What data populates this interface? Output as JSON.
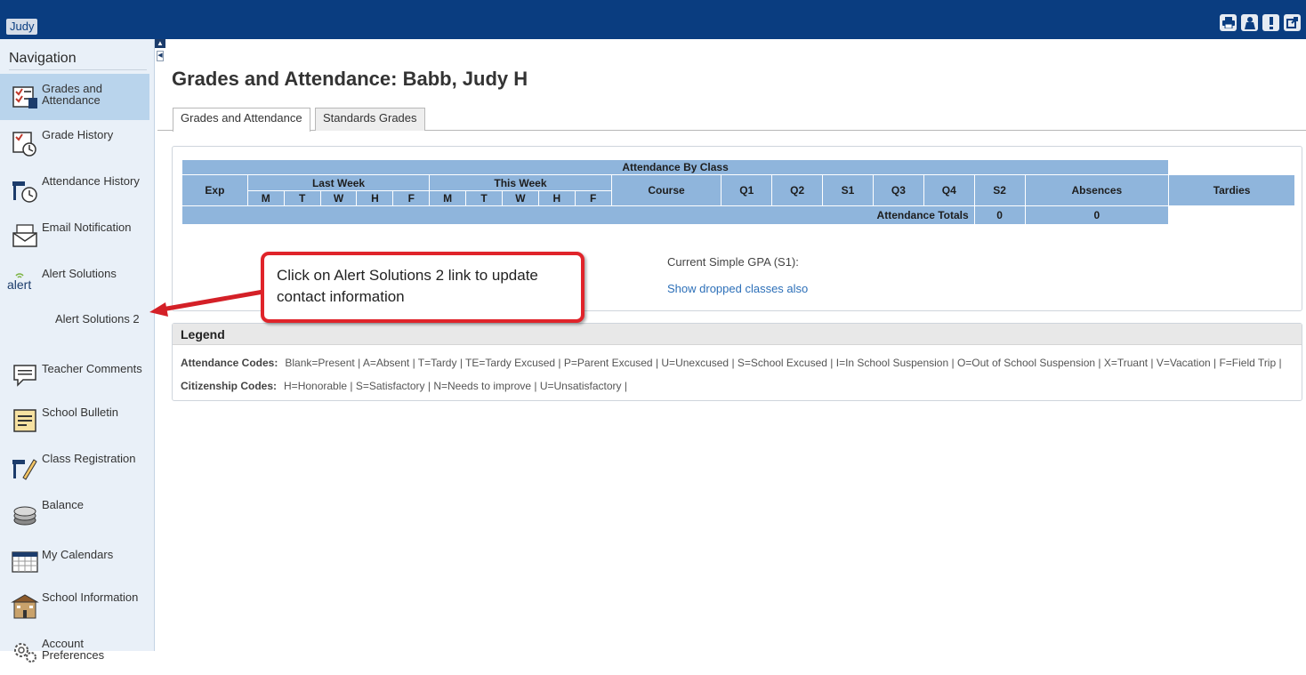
{
  "topbar": {
    "user": "Judy"
  },
  "navigation": {
    "title": "Navigation",
    "items": [
      {
        "label": "Grades and Attendance",
        "icon": "gradebook-icon",
        "active": true
      },
      {
        "label": "Grade History",
        "icon": "grade-history-icon"
      },
      {
        "label": "Attendance History",
        "icon": "attendance-history-icon"
      },
      {
        "label": "Email Notification",
        "icon": "email-icon"
      },
      {
        "label": "Alert Solutions",
        "icon": "alert-logo-icon"
      },
      {
        "label": "Alert Solutions 2",
        "icon": ""
      },
      {
        "label": "Teacher Comments",
        "icon": "comments-icon"
      },
      {
        "label": "School Bulletin",
        "icon": "bulletin-icon"
      },
      {
        "label": "Class Registration",
        "icon": "registration-icon"
      },
      {
        "label": "Balance",
        "icon": "coins-icon"
      },
      {
        "label": "My Calendars",
        "icon": "calendar-icon"
      },
      {
        "label": "School Information",
        "icon": "school-icon"
      },
      {
        "label": "Account Preferences",
        "icon": "gears-icon"
      }
    ]
  },
  "page": {
    "title": "Grades and Attendance: Babb, Judy H"
  },
  "tabs": [
    {
      "label": "Grades and Attendance",
      "active": true
    },
    {
      "label": "Standards Grades",
      "active": false
    }
  ],
  "attendance_table": {
    "caption": "Attendance By Class",
    "exp": "Exp",
    "last_week": "Last Week",
    "this_week": "This Week",
    "days": [
      "M",
      "T",
      "W",
      "H",
      "F"
    ],
    "course": "Course",
    "terms": [
      "Q1",
      "Q2",
      "S1",
      "Q3",
      "Q4",
      "S2"
    ],
    "absences": "Absences",
    "tardies": "Tardies",
    "totals_label": "Attendance Totals",
    "totals_absences": "0",
    "totals_tardies": "0"
  },
  "gpa": {
    "label": "Current Simple GPA (S1):"
  },
  "dropped_link": "Show dropped classes also",
  "callout": {
    "text": "Click on Alert Solutions 2 link to update contact information"
  },
  "legend": {
    "title": "Legend",
    "attendance_label": "Attendance Codes:",
    "attendance_codes": "Blank=Present | A=Absent | T=Tardy | TE=Tardy Excused | P=Parent Excused | U=Unexcused | S=School Excused | I=In School Suspension | O=Out of School Suspension | X=Truant | V=Vacation | F=Field Trip |",
    "citizenship_label": "Citizenship Codes:",
    "citizenship_codes": "H=Honorable | S=Satisfactory | N=Needs to improve | U=Unsatisfactory |"
  },
  "colors": {
    "topbar": "#0a3d80",
    "sidebar": "#e9f0f8",
    "active_nav": "#b9d4ec",
    "table_header": "#8fb5dc",
    "callout_border": "#e0242a",
    "link": "#2c6fb8"
  }
}
